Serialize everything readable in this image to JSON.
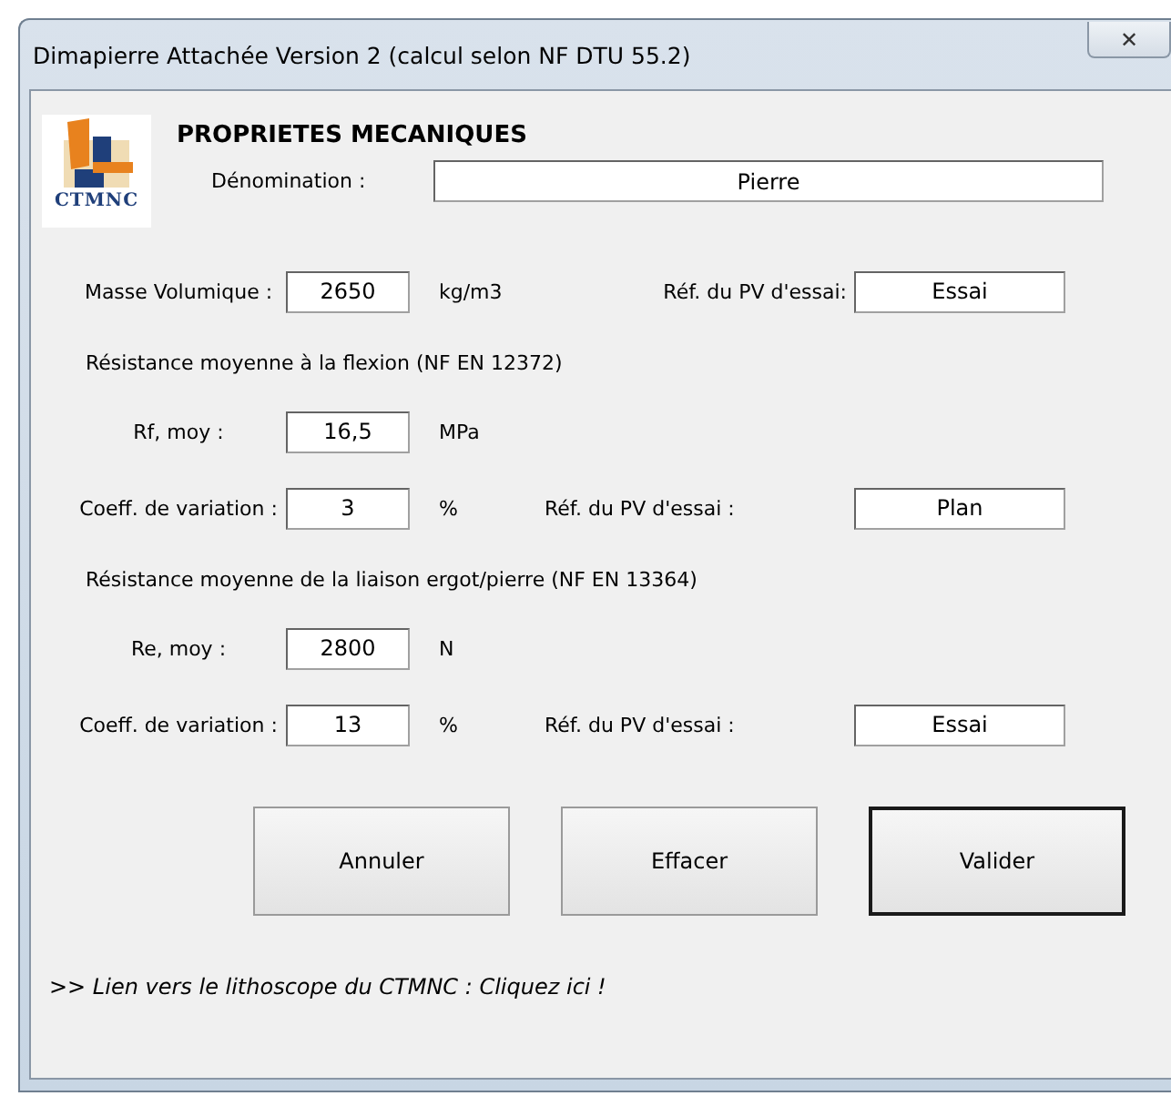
{
  "window": {
    "title": "Dimapierre Attachée Version 2 (calcul selon NF DTU 55.2)",
    "close": "✕"
  },
  "logo": {
    "text": "CTMNC"
  },
  "heading": "PROPRIETES MECANIQUES",
  "denomination": {
    "label": "Dénomination :",
    "value": "Pierre"
  },
  "blocks": [
    {
      "kind": "row",
      "label": "Masse Volumique :",
      "value": "2650",
      "unit": "kg/m3",
      "ref_label": "Réf. du PV d'essai:",
      "ref_value": "Essai"
    },
    {
      "kind": "section",
      "text": "Résistance moyenne à la flexion (NF EN 12372)"
    },
    {
      "kind": "row",
      "label": "Rf, moy :",
      "value": "16,5",
      "unit": "MPa"
    },
    {
      "kind": "row",
      "label": "Coeff. de variation :",
      "value": "3",
      "unit": "%",
      "ref_label": "Réf. du PV d'essai :",
      "ref_value": "Plan"
    },
    {
      "kind": "section",
      "text": "Résistance moyenne de la liaison ergot/pierre (NF EN 13364)"
    },
    {
      "kind": "row",
      "label": "Re, moy :",
      "value": "2800",
      "unit": "N"
    },
    {
      "kind": "row",
      "label": "Coeff. de variation :",
      "value": "13",
      "unit": "%",
      "ref_label": "Réf. du PV d'essai :",
      "ref_value": "Essai"
    }
  ],
  "buttons": [
    {
      "label": "Annuler",
      "default": false
    },
    {
      "label": "Effacer",
      "default": false
    },
    {
      "label": "Valider",
      "default": true
    }
  ],
  "link": ">> Lien vers le lithoscope du CTMNC : Cliquez ici !"
}
